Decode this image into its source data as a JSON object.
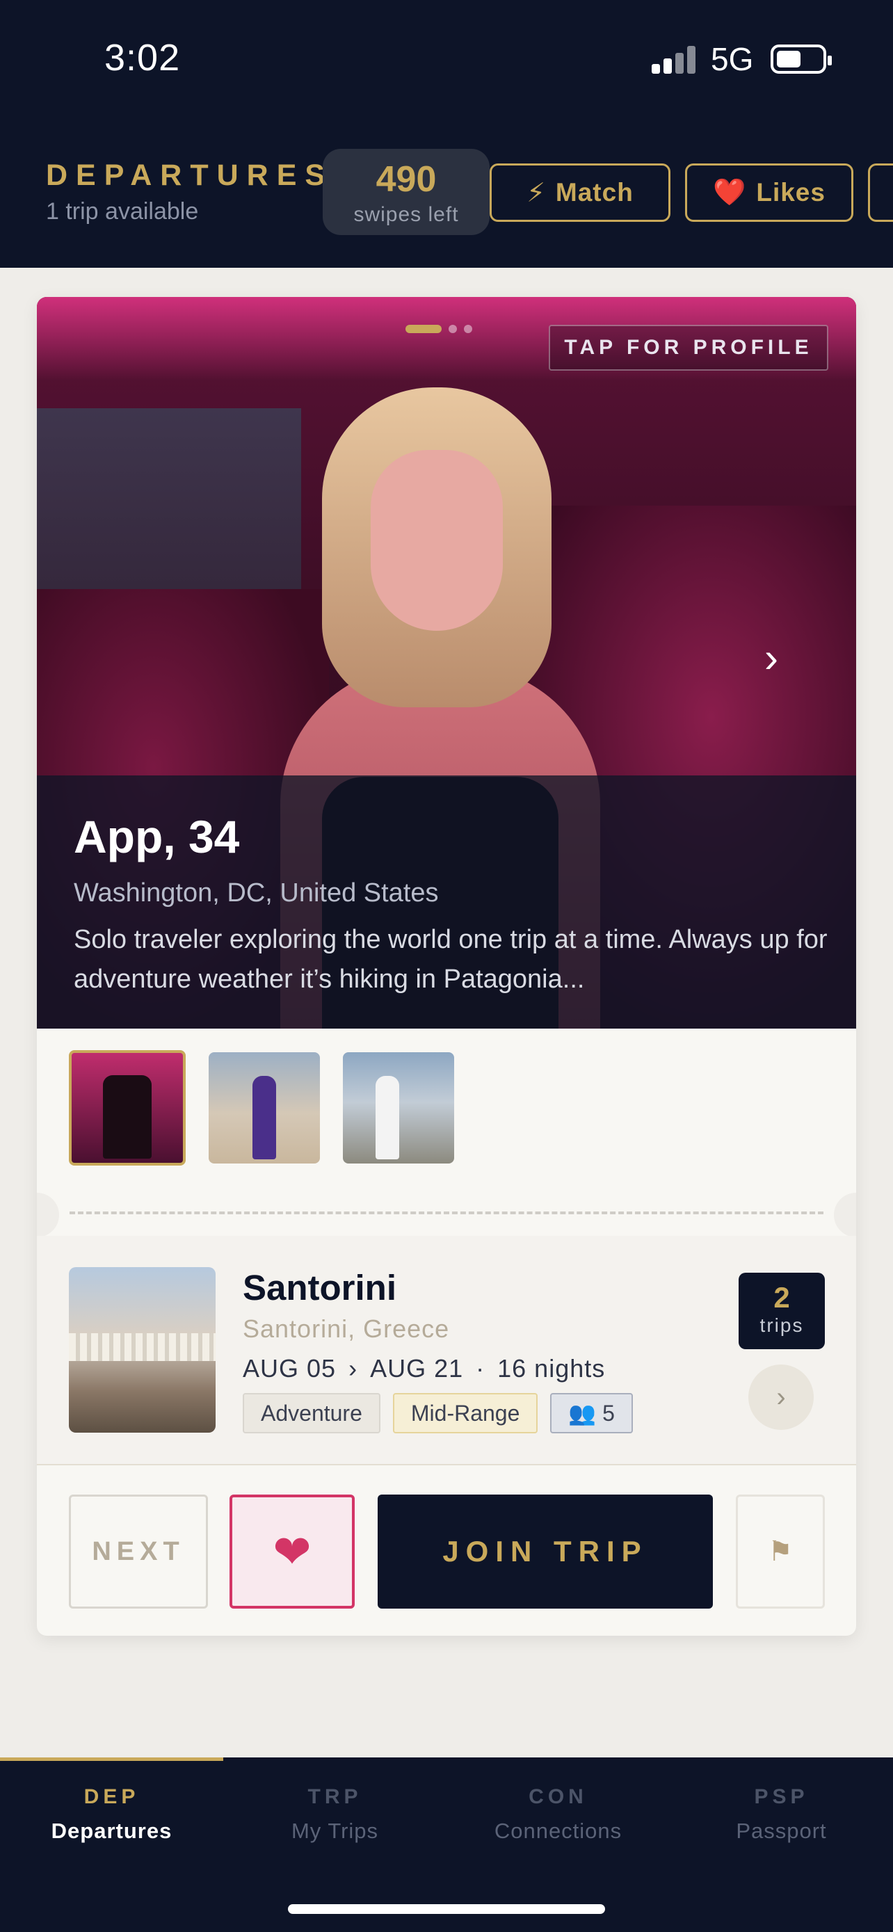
{
  "status": {
    "time": "3:02",
    "network": "5G"
  },
  "header": {
    "title": "DEPARTURES",
    "subtitle": "1 trip available",
    "swipes_count": "490",
    "swipes_label": "swipes left",
    "match_label": "Match",
    "match_icon": "⚡",
    "likes_label": "Likes",
    "likes_icon": "❤️"
  },
  "profile": {
    "tap_label": "TAP FOR PROFILE",
    "name_age": "App, 34",
    "location": "Washington, DC, United States",
    "bio": "Solo traveler exploring the world one trip at a time. Always up for adventure weather it’s hiking in Patagonia...",
    "photo_count": 3,
    "active_photo": 1
  },
  "trip": {
    "title": "Santorini",
    "location": "Santorini, Greece",
    "date_start": "AUG 05",
    "date_sep": "›",
    "date_end": "AUG 21",
    "dot": "·",
    "nights": "16 nights",
    "tags": [
      "Adventure",
      "Mid-Range"
    ],
    "group_size": "👥 5",
    "trips_count": "2",
    "trips_label": "trips"
  },
  "actions": {
    "next_label": "NEXT",
    "like_icon": "heart-icon",
    "join_label": "JOIN TRIP",
    "flag_icon": "flag-icon"
  },
  "tabs": [
    {
      "code": "DEP",
      "label": "Departures",
      "active": true
    },
    {
      "code": "TRP",
      "label": "My Trips",
      "active": false
    },
    {
      "code": "CON",
      "label": "Connections",
      "active": false
    },
    {
      "code": "PSP",
      "label": "Passport",
      "active": false
    }
  ],
  "colors": {
    "navy": "#0d1428",
    "gold": "#c9a95a",
    "rose": "#d33566",
    "cream": "#f8f7f3"
  }
}
